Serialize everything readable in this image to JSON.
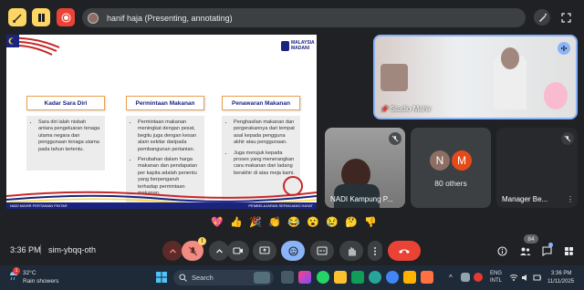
{
  "presenting_bar": {
    "label": "hanif haja (Presenting, annotating)"
  },
  "slide": {
    "logo_text_1": "MALAYSIA",
    "logo_text_2": "MADANI",
    "columns": [
      {
        "heading": "Kadar Sara Diri",
        "bullets": [
          "Sara diri ialah nisbah antara pengeluaran tenaga utama negara dan penggunaan tenaga utama pada tahun tertentu."
        ]
      },
      {
        "heading": "Permintaan Makanan",
        "bullets": [
          "Permintaan makanan meningkat dengan pesat, begitu juga dengan kesan alam sekitar daripada pembangunan pertanian.",
          "Perubahan dalam harga makanan dan pendapatan per kapita adalah penentu yang berpengaruh terhadap permintaan makanan."
        ]
      },
      {
        "heading": "Penawaran Makanan",
        "bullets": [
          "Penghasilan makanan dan pergerakannya dari tempat asal kepada pengguna akhir atau penggunaan.",
          "Juga merujuk kepada proses yang menerangkan cara makanan dari ladang berakhir di atas meja kami."
        ]
      }
    ],
    "footer_left": "NADI MAHIR PERTANIAN PINTAR",
    "footer_right": "PEMBELAJARAN SEPANJANG HAYAT"
  },
  "tiles": {
    "studio": "Studio Mahir",
    "nadi": "NADI Kampung P...",
    "others_label": "80 others",
    "others_initials": [
      "N",
      "M"
    ],
    "manager": "Manager Be..."
  },
  "reactions": [
    "💖",
    "👍",
    "🎉",
    "👏",
    "😂",
    "😮",
    "😢",
    "🤔",
    "👎"
  ],
  "meeting": {
    "time": "3:36 PM",
    "code": "sim-ybqq-oth",
    "people_count": "84"
  },
  "taskbar": {
    "weather_temp": "32°C",
    "weather_desc": "Rain showers",
    "weather_badge": "1",
    "search_placeholder": "Search",
    "lang_1": "ENG",
    "lang_2": "INTL",
    "clock_time": "3:36 PM",
    "clock_date": "11/11/2025"
  },
  "colors": {
    "meet_bg": "#202124",
    "control_bg": "#3c4043",
    "end_call": "#ea4335",
    "active_blue": "#8ab4f8",
    "mic_muted": "#f28b82",
    "avatar_n": "#8d6e63",
    "avatar_m": "#e64a19",
    "slide_navy": "#1a237e"
  }
}
